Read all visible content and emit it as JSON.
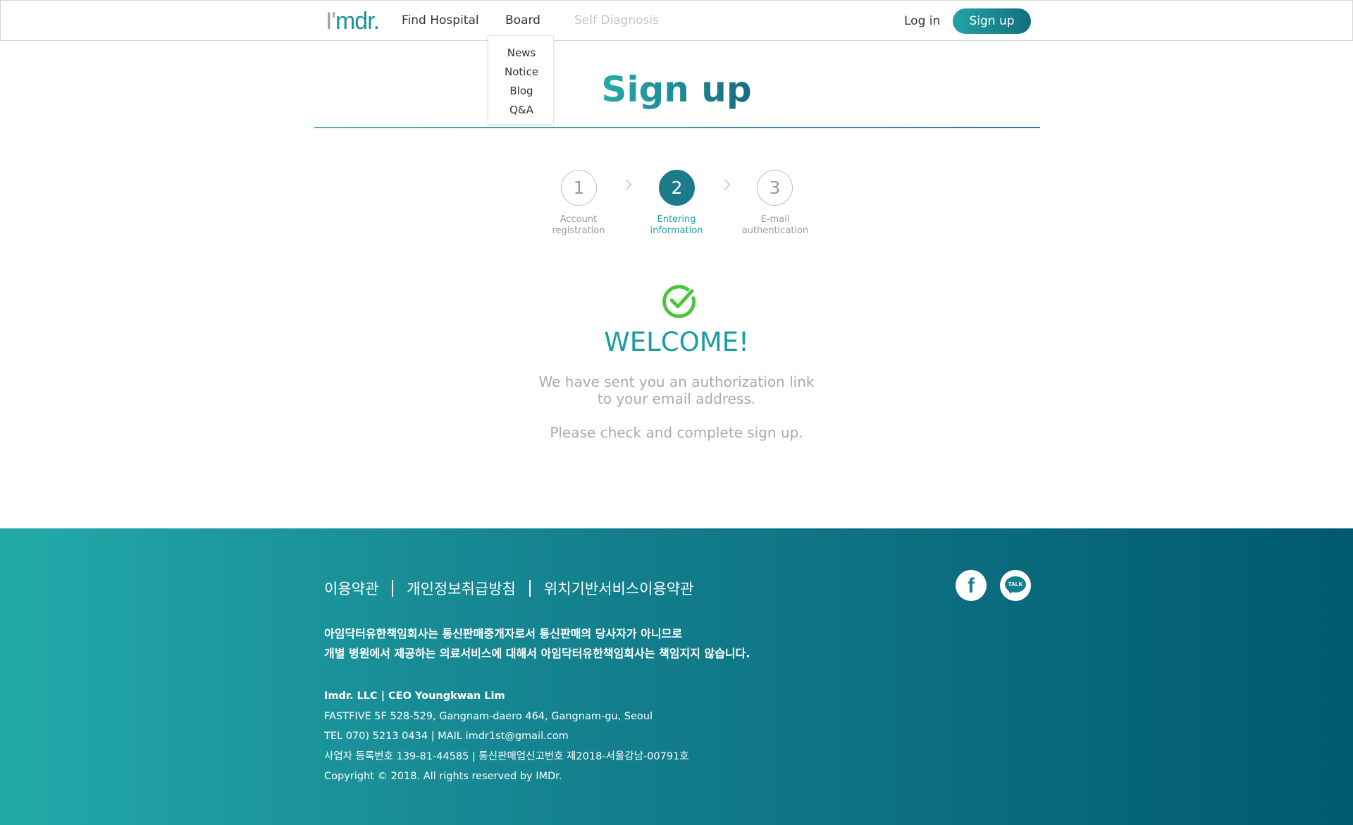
{
  "header": {
    "logo_prefix": "I'",
    "logo_suffix": "mdr.",
    "nav": [
      "Find Hospital",
      "Board",
      "Self Diagnosis"
    ],
    "login": "Log in",
    "signup": "Sign up"
  },
  "board_menu": [
    "News",
    "Notice",
    "Blog",
    "Q&A"
  ],
  "page": {
    "title": "Sign up"
  },
  "steps": [
    {
      "number": "1",
      "label_line1": "Account",
      "label_line2": "registration",
      "active": false
    },
    {
      "number": "2",
      "label_line1": "Entering",
      "label_line2": "information",
      "active": true
    },
    {
      "number": "3",
      "label_line1": "E-mail",
      "label_line2": "authentication",
      "active": false
    }
  ],
  "welcome": {
    "heading": "WELCOME!",
    "line1": "We have sent you an authorization link",
    "line2": "to your email address.",
    "line3": "Please check and complete sign up."
  },
  "footer": {
    "links": [
      "이용약관",
      "개인정보취급방침",
      "위치기반서비스이용약관"
    ],
    "notice_line1": "아임닥터유한책임회사는 통신판매중개자로서 통신판매의 당사자가 아니므로",
    "notice_line2": "개별 병원에서 제공하는 의료서비스에 대해서 아임닥터유한책임회사는 책임지지 않습니다.",
    "info": [
      "Imdr. LLC | CEO Youngkwan Lim",
      "FASTFIVE 5F 528-529, Gangnam-daero 464, Gangnam-gu, Seoul",
      "TEL 070) 5213 0434 | MAIL  imdr1st@gmail.com",
      "사업자 등록번호 139-81-44585 | 통신판매업신고번호 제2018-서울강남-00791호",
      "Copyright © 2018. All rights reserved by IMDr."
    ],
    "social": {
      "facebook_glyph": "f",
      "talk_glyph": "TALK"
    }
  },
  "colors": {
    "accent": "#1c7b8a",
    "accent_light": "#22a4a6",
    "check_green": "#4cc43c",
    "footer_gradient_start": "#23a9a8",
    "footer_gradient_end": "#01596f"
  }
}
